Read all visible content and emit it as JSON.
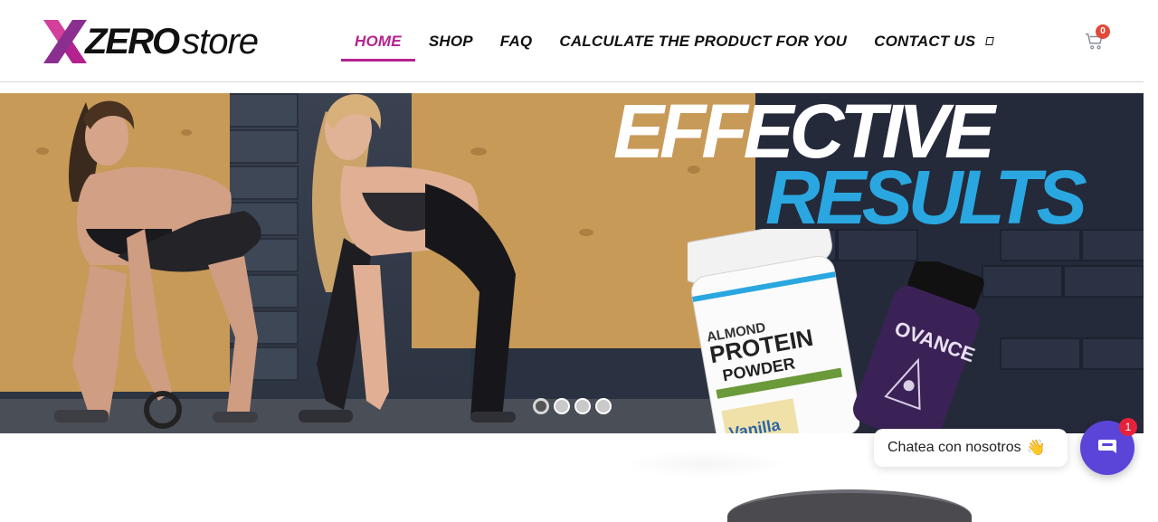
{
  "logo": {
    "x_letter": "X",
    "zero": "ZERO",
    "store": "store"
  },
  "nav": {
    "items": [
      {
        "label": "HOME",
        "active": true
      },
      {
        "label": "SHOP",
        "active": false
      },
      {
        "label": "FAQ",
        "active": false
      },
      {
        "label": "CALCULATE THE PRODUCT FOR YOU",
        "active": false
      },
      {
        "label": "CONTACT US",
        "active": false
      }
    ]
  },
  "cart": {
    "count": "0"
  },
  "hero": {
    "headline_line1": "EFFECTIVE",
    "headline_line2": "RESULTS",
    "product_tub": {
      "line1": "ALMOND",
      "line2": "PROTEIN",
      "line3": "POWDER",
      "flavor": "Vanilla"
    },
    "product_bottle": {
      "label": "OVANCE"
    },
    "slides": 4,
    "active_slide": 1
  },
  "chat": {
    "bubble_text": "Chatea con nosotros",
    "emoji": "👋",
    "unread": "1"
  },
  "colors": {
    "accent": "#b4228f",
    "headline_blue": "#2aa7e0",
    "chat_purple": "#5b45d8"
  }
}
